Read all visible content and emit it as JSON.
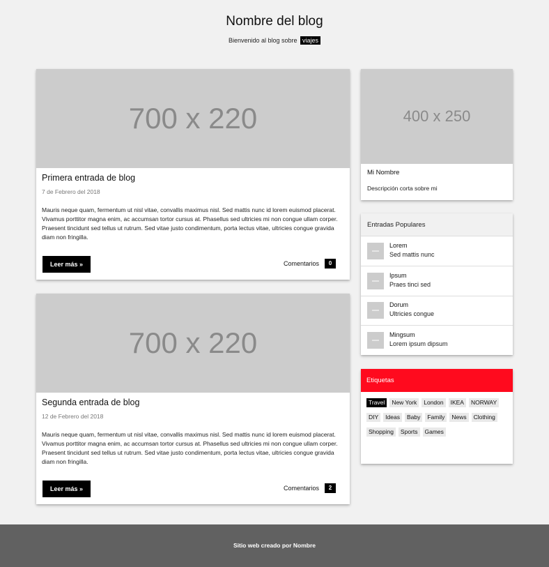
{
  "header": {
    "title": "Nombre del blog",
    "tagline_prefix": "Bienvenido al blog sobre",
    "tagline_highlight": "viajes"
  },
  "posts": [
    {
      "image_text": "700 x 220",
      "title": "Primera entrada de blog",
      "date": "7 de Febrero del 2018",
      "body": "Mauris neque quam, fermentum ut nisl vitae, convallis maximus nisl. Sed mattis nunc id lorem euismod placerat. Vivamus porttitor magna enim, ac accumsan tortor cursus at. Phasellus sed ultricies mi non congue ullam corper. Praesent tincidunt sed tellus ut rutrum. Sed vitae justo condimentum, porta lectus vitae, ultricies congue gravida diam non fringilla.",
      "read_more": "Leer más »",
      "comments_label": "Comentarios",
      "comments_count": "0"
    },
    {
      "image_text": "700 x 220",
      "title": "Segunda entrada de blog",
      "date": "12 de Febrero del 2018",
      "body": "Mauris neque quam, fermentum ut nisl vitae, convallis maximus nisl. Sed mattis nunc id lorem euismod placerat. Vivamus porttitor magna enim, ac accumsan tortor cursus at. Phasellus sed ultricies mi non congue ullam corper. Praesent tincidunt sed tellus ut rutrum. Sed vitae justo condimentum, porta lectus vitae, ultricies congue gravida diam non fringilla.",
      "read_more": "Leer más »",
      "comments_label": "Comentarios",
      "comments_count": "2"
    }
  ],
  "profile": {
    "image_text": "400 x 250",
    "name": "Mi Nombre",
    "description": "Descripción corta sobre mi"
  },
  "popular": {
    "heading": "Entradas Populares",
    "items": [
      {
        "title": "Lorem",
        "subtitle": "Sed mattis nunc"
      },
      {
        "title": "Ipsum",
        "subtitle": "Praes tinci sed"
      },
      {
        "title": "Dorum",
        "subtitle": "Ultricies congue"
      },
      {
        "title": "Mingsum",
        "subtitle": "Lorem ipsum dipsum"
      }
    ]
  },
  "tags": {
    "heading": "Etiquetas",
    "items": [
      "Travel",
      "New York",
      "London",
      "IKEA",
      "NORWAY",
      "DIY",
      "Ideas",
      "Baby",
      "Family",
      "News",
      "Clothing",
      "Shopping",
      "Sports",
      "Games"
    ]
  },
  "footer": {
    "text": "Sitio web creado por Nombre"
  },
  "colors": {
    "page_bg": "#f1f1f1",
    "accent_red": "#ff0a1e",
    "footer_bg": "#616161",
    "placeholder_gray": "#cccccc"
  },
  "icons": {
    "popular_thumb": "image-placeholder-icon"
  }
}
